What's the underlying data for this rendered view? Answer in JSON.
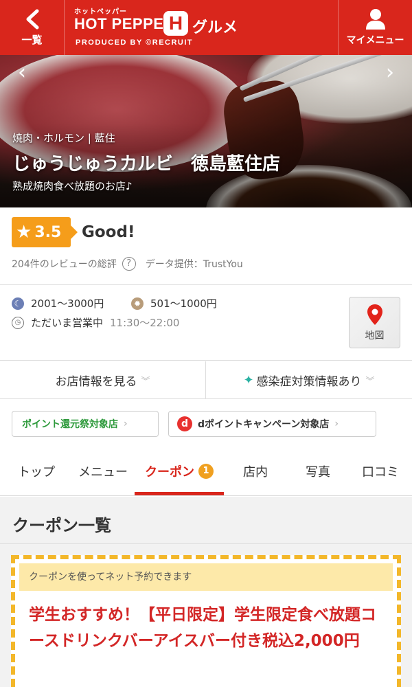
{
  "header": {
    "back_label": "一覧",
    "logo_small": "ホットペッパー",
    "logo_main": "HOT PEPPER",
    "logo_h": "H",
    "logo_gourmet": "グルメ",
    "logo_produced": "PRODUCED BY ©RECRUIT",
    "mymenu_label": "マイメニュー"
  },
  "hero": {
    "genre": "焼肉・ホルモン | 藍住",
    "shop_name": "じゅうじゅうカルビ　徳島藍住店",
    "catch": "熟成焼肉食べ放題のお店♪",
    "prev_arrow": "‹",
    "next_arrow": "›"
  },
  "rating": {
    "score": "3.5",
    "word": "Good!",
    "reviews": "204件のレビューの総評",
    "help": "?",
    "provider": "データ提供：TrustYou"
  },
  "info": {
    "dinner_budget": "2001〜3000円",
    "lunch_budget": "501〜1000円",
    "status": "ただいま営業中",
    "hours": "11:30〜22:00",
    "map_label": "地図"
  },
  "links": {
    "shop_info": "お店情報を見る",
    "covid": "感染症対策情報あり"
  },
  "tags": {
    "point_fest": "ポイント還元祭対象店",
    "dpoint": "dポイントキャンペーン対象店"
  },
  "tabs": [
    {
      "label": "トップ"
    },
    {
      "label": "メニュー"
    },
    {
      "label": "クーポン",
      "count": "1"
    },
    {
      "label": "店内"
    },
    {
      "label": "写真"
    },
    {
      "label": "口コミ"
    }
  ],
  "coupon": {
    "section_title": "クーポン一覧",
    "note": "クーポンを使ってネット予約できます",
    "title": "学生おすすめ！【平日限定】学生限定食べ放題コースドリンクバーアイスバー付き税込2,000円"
  },
  "colors": {
    "brand_red": "#d9261c",
    "rating_orange": "#f59d1a",
    "point_green": "#2e9a3c",
    "coupon_border": "#f3b72a"
  },
  "icons": {
    "back": "chevron-left-icon",
    "mymenu": "person-icon",
    "map": "map-pin-icon",
    "star": "star-icon",
    "dinner": "moon-icon",
    "lunch": "sun-icon",
    "hours": "clock-icon"
  }
}
